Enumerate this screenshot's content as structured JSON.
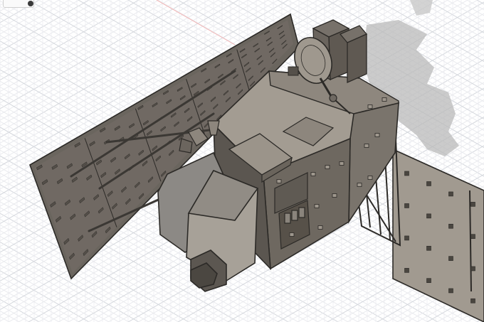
{
  "app": {
    "type": "3D CAD modeling viewport"
  },
  "viewport": {
    "background": "#ffffff",
    "grid_minor_color": "#e9eaee",
    "grid_major_color": "#d3d6dc",
    "axis_color": "#f2b3b3"
  },
  "toolbar": {
    "visibility_toggle_icon": "eye-icon",
    "toggle_color": "#3a3a3a"
  },
  "model": {
    "name": "satellite",
    "body_top_color": "#a39c92",
    "body_side_color": "#6e6860",
    "body_dark_color": "#5b5650",
    "panel_color": "#6a655e",
    "instrument_color": "#8c8985",
    "edge_color": "#2c2a27",
    "shadow_color": "#b9b9b9"
  }
}
